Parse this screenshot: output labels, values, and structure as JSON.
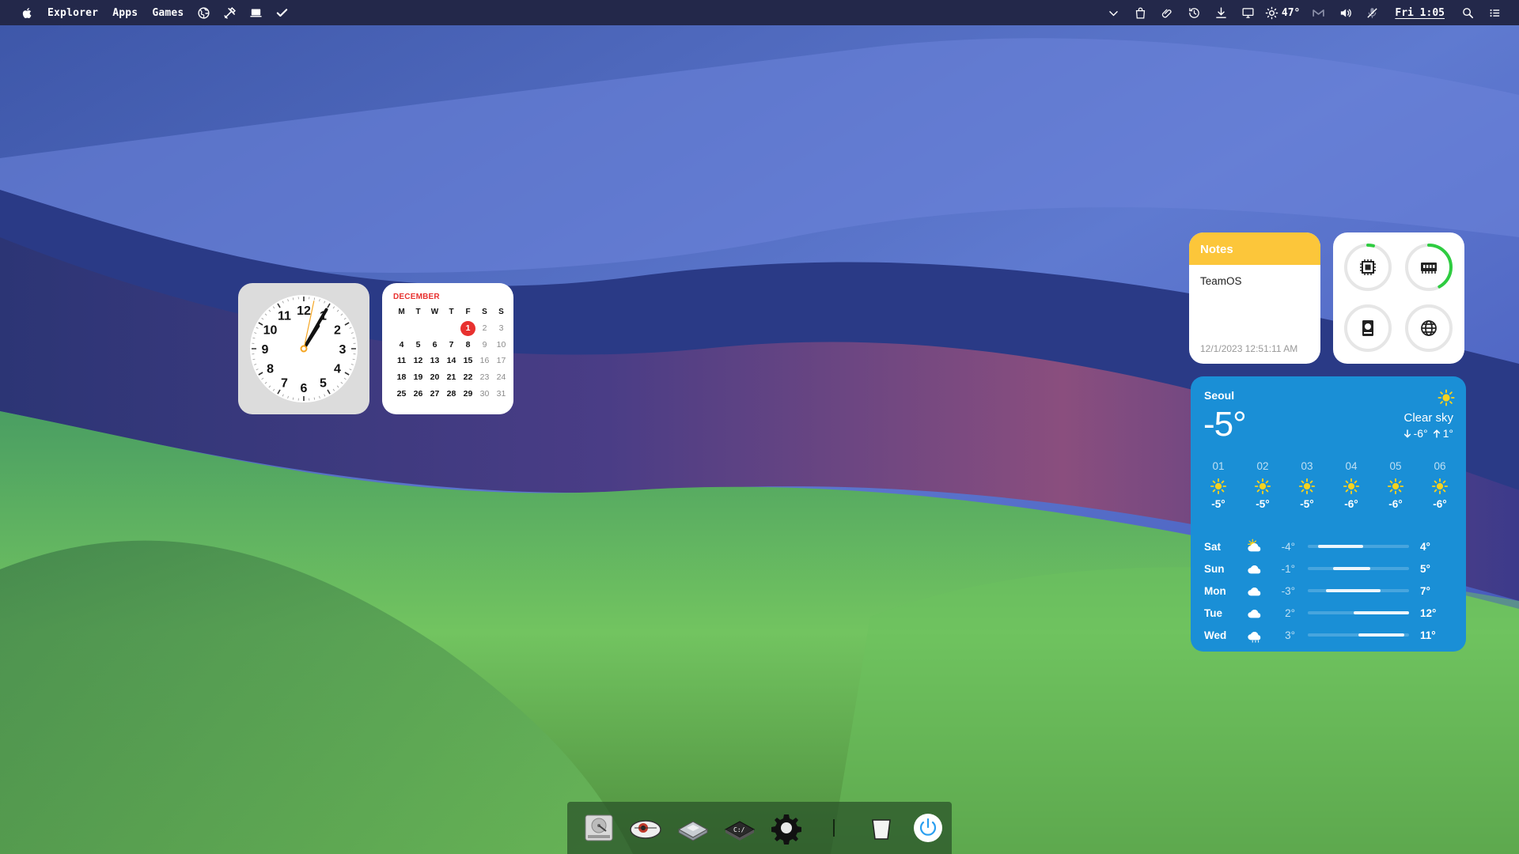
{
  "menubar": {
    "apple_icon": "apple-icon",
    "items": [
      "Explorer",
      "Apps",
      "Games"
    ],
    "left_icons": [
      "globe-icon",
      "tools-icon",
      "laptop-icon",
      "checkmark-icon"
    ],
    "right_icons": [
      "chevron-down-icon",
      "shopping-bag-icon",
      "paperclip-icon",
      "history-icon",
      "download-icon",
      "display-icon"
    ],
    "weather_icon": "sun-icon",
    "temperature": "47°",
    "right_icons_2": [
      "gmail-icon",
      "volume-icon",
      "mic-off-icon"
    ],
    "datetime": "Fri 1:05",
    "tail_icons": [
      "search-icon",
      "list-icon"
    ]
  },
  "clock_widget": {
    "numbers": [
      "12",
      "1",
      "2",
      "3",
      "4",
      "5",
      "6",
      "7",
      "8",
      "9",
      "10",
      "11"
    ],
    "time": "1:05",
    "hand_color": "#111111",
    "second_hand_color": "#f5a623"
  },
  "calendar_widget": {
    "month": "DECEMBER",
    "weekdays": [
      "M",
      "T",
      "W",
      "T",
      "F",
      "S",
      "S"
    ],
    "weeks": [
      [
        "",
        "",
        "",
        "",
        "1",
        "2",
        "3"
      ],
      [
        "4",
        "5",
        "6",
        "7",
        "8",
        "9",
        "10"
      ],
      [
        "11",
        "12",
        "13",
        "14",
        "15",
        "16",
        "17"
      ],
      [
        "18",
        "19",
        "20",
        "21",
        "22",
        "23",
        "24"
      ],
      [
        "25",
        "26",
        "27",
        "28",
        "29",
        "30",
        "31"
      ]
    ],
    "today": "1",
    "accent_color": "#e8312f"
  },
  "notes_widget": {
    "title": "Notes",
    "content": "TeamOS",
    "timestamp": "12/1/2023 12:51:11 AM",
    "header_color": "#fcc63a"
  },
  "system_widget": {
    "gauges": [
      {
        "name": "cpu",
        "icon": "cpu-icon",
        "fraction": 0.04
      },
      {
        "name": "memory",
        "icon": "memory-icon",
        "fraction": 0.42
      },
      {
        "name": "disk",
        "icon": "disk-icon",
        "fraction": 0.0
      },
      {
        "name": "network",
        "icon": "globe-icon",
        "fraction": 0.0
      }
    ],
    "gauge_color": "#2ecc40",
    "track_color": "#e6e6e6"
  },
  "weather_widget": {
    "city": "Seoul",
    "temperature": "-5°",
    "condition": "Clear sky",
    "low": "-6°",
    "high": "1°",
    "hourly": [
      {
        "hour": "01",
        "icon": "sun-icon",
        "temp": "-5°"
      },
      {
        "hour": "02",
        "icon": "sun-icon",
        "temp": "-5°"
      },
      {
        "hour": "03",
        "icon": "sun-icon",
        "temp": "-5°"
      },
      {
        "hour": "04",
        "icon": "sun-icon",
        "temp": "-6°"
      },
      {
        "hour": "05",
        "icon": "sun-icon",
        "temp": "-6°"
      },
      {
        "hour": "06",
        "icon": "sun-icon",
        "temp": "-6°"
      }
    ],
    "daily": [
      {
        "day": "Sat",
        "icon": "partly-cloudy-icon",
        "low": "-4°",
        "high": "4°",
        "bar_start": 0.1,
        "bar_end": 0.55
      },
      {
        "day": "Sun",
        "icon": "cloud-icon",
        "low": "-1°",
        "high": "5°",
        "bar_start": 0.25,
        "bar_end": 0.62
      },
      {
        "day": "Mon",
        "icon": "cloud-icon",
        "low": "-3°",
        "high": "7°",
        "bar_start": 0.18,
        "bar_end": 0.72
      },
      {
        "day": "Tue",
        "icon": "cloud-icon",
        "low": "2°",
        "high": "12°",
        "bar_start": 0.45,
        "bar_end": 1.0
      },
      {
        "day": "Wed",
        "icon": "rain-cloud-icon",
        "low": "3°",
        "high": "11°",
        "bar_start": 0.5,
        "bar_end": 0.95
      }
    ],
    "background_color": "#1a8fd6",
    "sun_color": "#f7d21e"
  },
  "dock": {
    "items": [
      "hard-drive-icon",
      "browser-icon",
      "disk-utility-icon",
      "terminal-icon",
      "settings-gear-icon",
      "trash-icon",
      "power-icon"
    ]
  }
}
